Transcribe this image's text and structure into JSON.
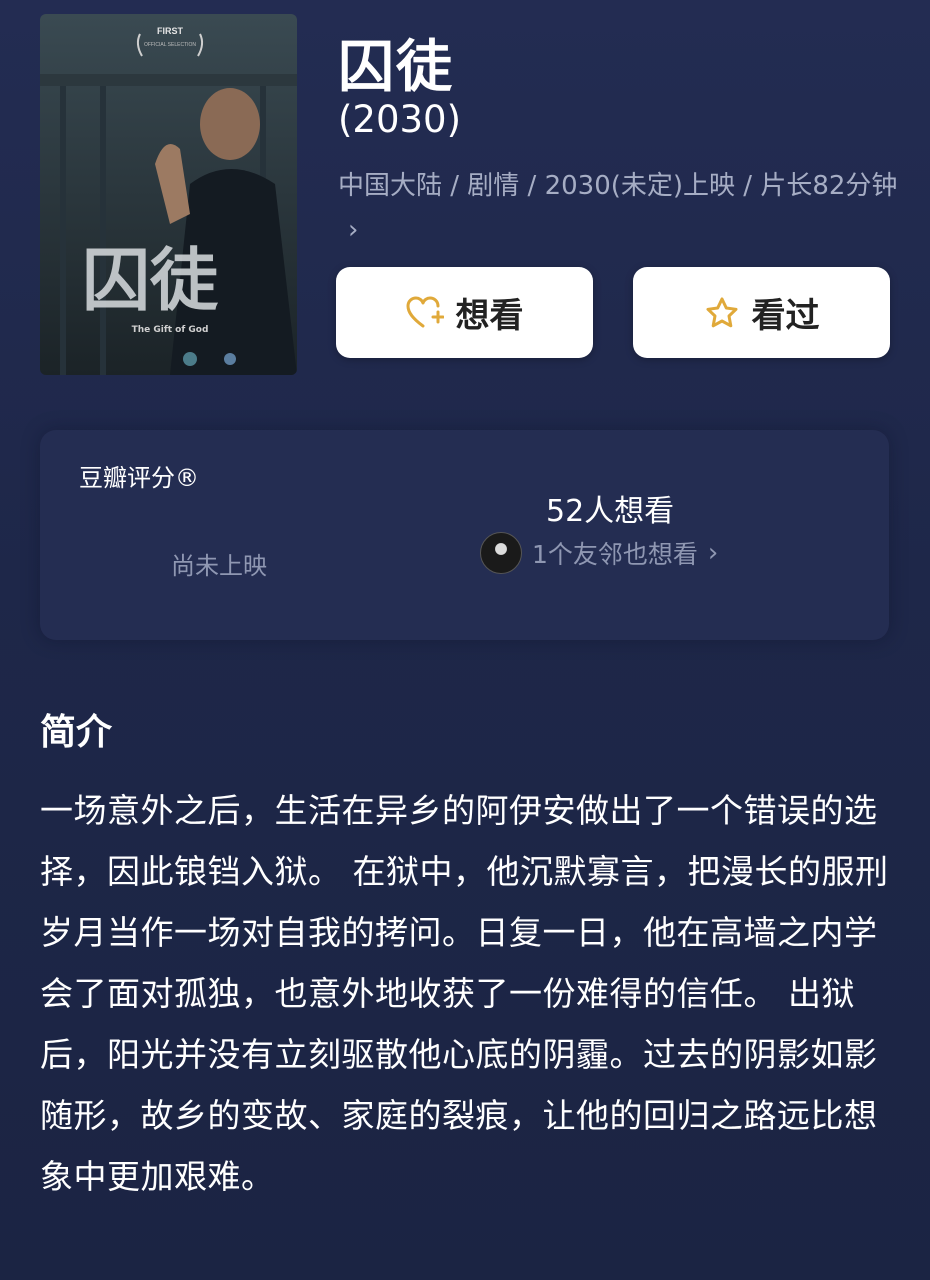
{
  "movie": {
    "title": "囚徒",
    "year": "(2030)",
    "meta_line": "中国大陆 / 剧情 / 2030(未定)上映 / 片长82分钟",
    "poster": {
      "festival": "FIRST",
      "title_cn": "囚徒",
      "title_en": "The Gift of God"
    }
  },
  "actions": {
    "want_label": "想看",
    "seen_label": "看过"
  },
  "rating": {
    "label": "豆瓣评分®",
    "status": "尚未上映",
    "want_count": "52人想看",
    "friends_text": "1个友邻也想看"
  },
  "synopsis": {
    "heading": "简介",
    "text": "一场意外之后，生活在异乡的阿伊安做出了一个错误的选择，因此锒铛入狱。 在狱中，他沉默寡言，把漫长的服刑岁月当作一场对自我的拷问。日复一日，他在高墙之内学会了面对孤独，也意外地收获了一份难得的信任。 出狱后，阳光并没有立刻驱散他心底的阴霾。过去的阴影如影随形，故乡的变故、家庭的裂痕，让他的回归之路远比想象中更加艰难。"
  },
  "colors": {
    "background": "#1e2749",
    "accent": "#e0a93a",
    "muted_text": "#a6adc4"
  }
}
